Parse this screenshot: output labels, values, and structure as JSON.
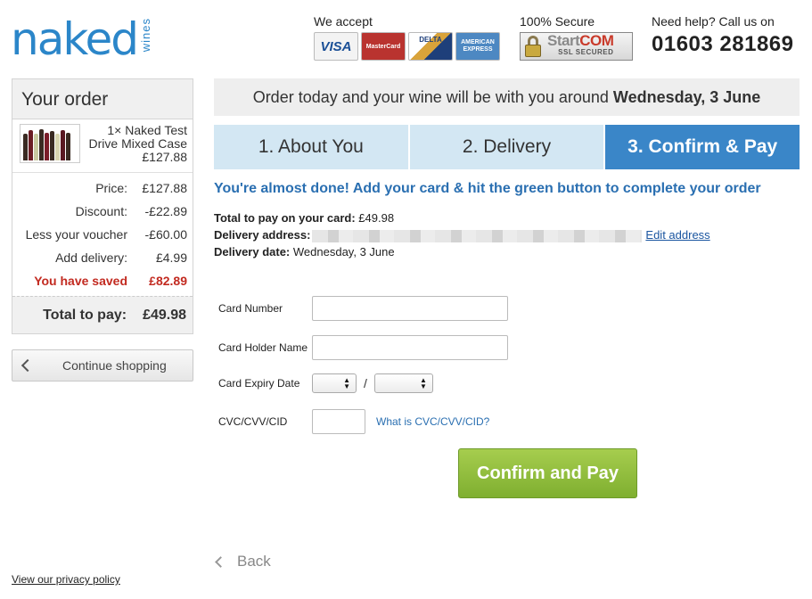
{
  "brand": {
    "logo_main": "naked",
    "logo_sub": "wines"
  },
  "header": {
    "accept_label": "We accept",
    "cards": [
      {
        "icon": "visa-card-icon",
        "text": "VISA"
      },
      {
        "icon": "mastercard-icon",
        "text": "MasterCard"
      },
      {
        "icon": "delta-card-icon",
        "text": "DELTA"
      },
      {
        "icon": "amex-card-icon",
        "text": "AMERICAN EXPRESS"
      }
    ],
    "secure_label": "100% Secure",
    "ssl_brand_a": "Start",
    "ssl_brand_b": "COM",
    "ssl_sub": "SSL SECURED",
    "help_label": "Need help? Call us on",
    "phone": "01603 281869"
  },
  "order": {
    "title": "Your order",
    "product_line1": "1× Naked Test",
    "product_line2": "Drive Mixed Case",
    "product_price": "£127.88",
    "summary": [
      {
        "label": "Price:",
        "value": "£127.88"
      },
      {
        "label": "Discount:",
        "value": "-£22.89"
      },
      {
        "label": "Less your voucher",
        "value": "-£60.00"
      },
      {
        "label": "Add delivery:",
        "value": "£4.99"
      }
    ],
    "saved_label": "You have saved",
    "saved_value": "£82.89",
    "total_label": "Total to pay:",
    "total_value": "£49.98"
  },
  "continue_label": "Continue shopping",
  "privacy_label": "View our privacy policy",
  "delivery_banner": {
    "text": "Order today and your wine will be with you around",
    "date": "Wednesday, 3 June"
  },
  "steps": [
    "1. About You",
    "2. Delivery",
    "3. Confirm & Pay"
  ],
  "almost_done": "You're almost done! Add your card & hit the green button to complete your order",
  "info": {
    "total_label": "Total to pay on your card:",
    "total_value": "£49.98",
    "address_label": "Delivery address:",
    "edit_address": "Edit address",
    "date_label": "Delivery date:",
    "date_value": "Wednesday, 3 June"
  },
  "form": {
    "card_number_label": "Card Number",
    "card_holder_label": "Card Holder Name",
    "expiry_label": "Card Expiry Date",
    "expiry_separator": "/",
    "cvc_label": "CVC/CVV/CID",
    "cvc_help": "What is CVC/CVV/CID?"
  },
  "confirm_label": "Confirm and Pay",
  "back_label": "Back",
  "colors": {
    "brand_blue": "#2b86c9",
    "step_active": "#3a86c8",
    "confirm_green": "#8fbd3c",
    "saved_red": "#c22a20"
  }
}
